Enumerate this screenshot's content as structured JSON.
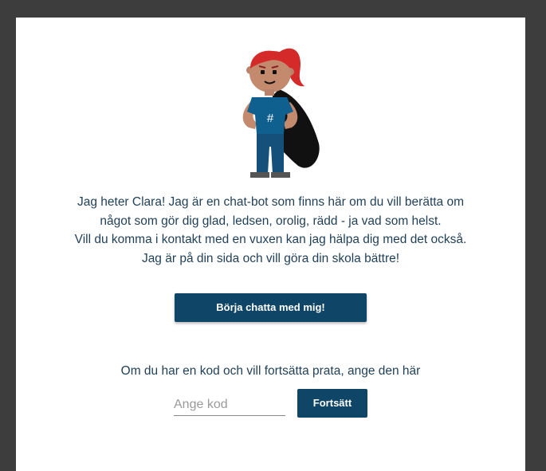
{
  "mascot": {
    "icon": "clara-superhero-mascot",
    "shirt_symbol": "#"
  },
  "intro": {
    "lines": [
      "Jag heter Clara! Jag är en chat-bot som finns här om du vill berätta om",
      "något som gör dig glad, ledsen, orolig, rädd - ja vad som helst.",
      "Vill du komma i kontakt med en vuxen kan jag hälpa dig med det också.",
      "Jag är på din sida och vill göra din skola bättre!"
    ]
  },
  "start_button": {
    "label": "Börja chatta med mig!"
  },
  "resume": {
    "prompt": "Om du har en kod och vill fortsätta prata, ange den här",
    "code_placeholder": "Ange kod",
    "code_value": "",
    "continue_label": "Fortsätt"
  },
  "colors": {
    "background": "#3d3d3d",
    "card": "#ffffff",
    "text": "#1f3f57",
    "button": "#0f4566",
    "mascot_hair": "#d42a2a",
    "mascot_shirt": "#0f5f8f",
    "mascot_cape": "#111111"
  }
}
